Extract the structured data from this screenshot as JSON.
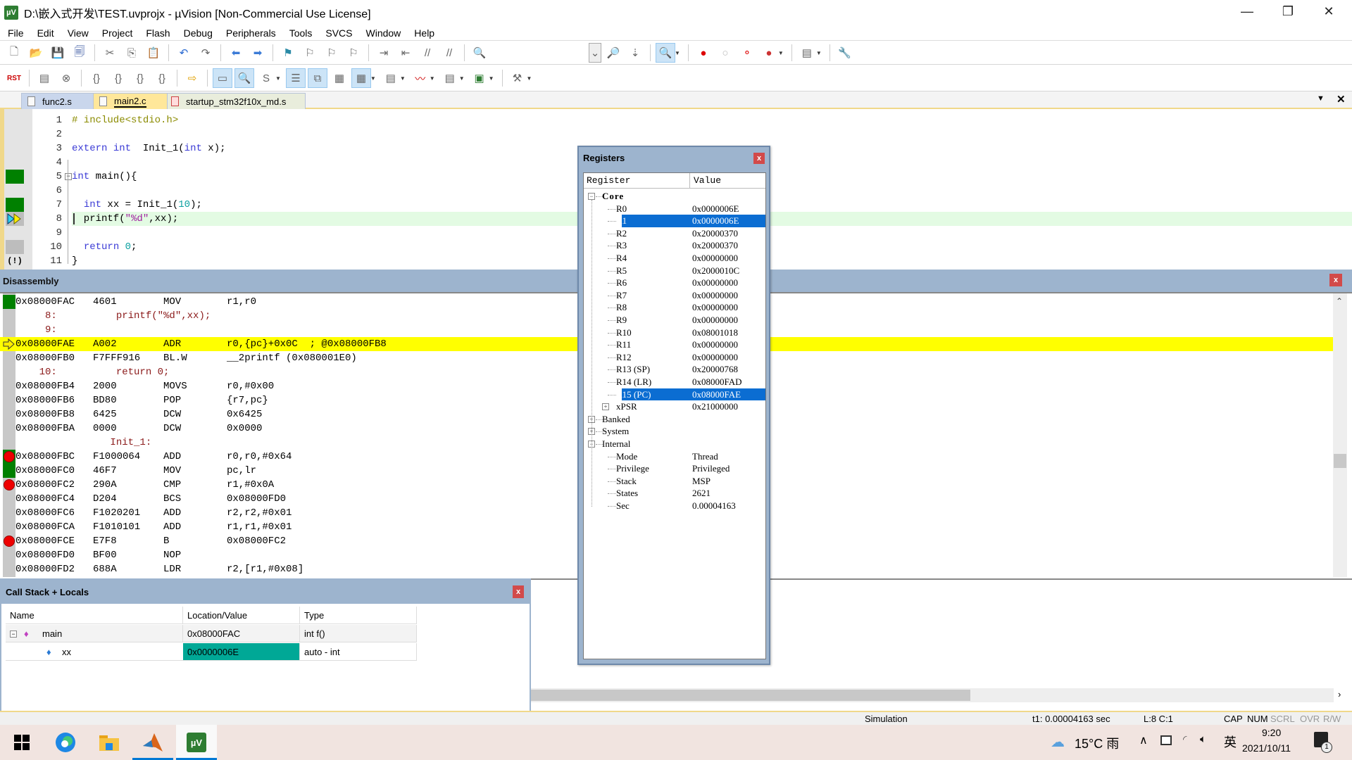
{
  "window": {
    "title": "D:\\嵌入式开发\\TEST.uvprojx - µVision  [Non-Commercial Use License]",
    "app_icon_label": "µV",
    "controls": {
      "minimize": "—",
      "restore": "❐",
      "close": "✕"
    }
  },
  "menu": [
    "File",
    "Edit",
    "View",
    "Project",
    "Flash",
    "Debug",
    "Peripherals",
    "Tools",
    "SVCS",
    "Window",
    "Help"
  ],
  "toolbar1": {
    "icons": [
      "new-file",
      "open-file",
      "save",
      "save-all",
      "cut",
      "copy",
      "paste",
      "undo",
      "redo",
      "navigate-back",
      "navigate-forward",
      "bookmark",
      "prev-bookmark",
      "next-bookmark",
      "clear-bookmarks",
      "indent",
      "unindent",
      "comment",
      "uncomment",
      "find-in-files"
    ],
    "right_icons": [
      "target-dropdown",
      "find",
      "incremental-find",
      "debug-session",
      "insert-breakpoint",
      "enable-breakpoint",
      "disable-all-breakpoints",
      "kill-all-breakpoints",
      "window-layout",
      "configure"
    ]
  },
  "toolbar2": {
    "icons": [
      "reset",
      "run",
      "stop",
      "step-into",
      "step-over",
      "step-out",
      "run-to-cursor",
      "show-next-statement",
      "command-window",
      "disassembly-window",
      "symbols-window",
      "registers-window",
      "call-stack-window",
      "watch-windows",
      "memory-windows",
      "serial-windows",
      "analysis-windows",
      "trace-windows",
      "system-viewer",
      "toolbox"
    ],
    "reset_label": "RST"
  },
  "tabs": [
    {
      "label": "func2.s",
      "active": false
    },
    {
      "label": "main2.c",
      "active": true
    },
    {
      "label": "startup_stm32f10x_md.s",
      "active": false
    }
  ],
  "tabbar_controls": {
    "dropdown": "▼",
    "close": "✕"
  },
  "editor": {
    "lines": [
      {
        "n": "1",
        "code": "# include<stdio.h>"
      },
      {
        "n": "2",
        "code": ""
      },
      {
        "n": "3",
        "code": "extern int  Init_1(int x);"
      },
      {
        "n": "4",
        "code": ""
      },
      {
        "n": "5",
        "code": "int main(){"
      },
      {
        "n": "6",
        "code": ""
      },
      {
        "n": "7",
        "code": "  int xx = Init_1(10);"
      },
      {
        "n": "8",
        "code": "  printf(\"%d\",xx);"
      },
      {
        "n": "9",
        "code": ""
      },
      {
        "n": "10",
        "code": "  return 0;"
      },
      {
        "n": "11",
        "code": "}"
      }
    ],
    "current_line": 8,
    "warning_glyph": "!"
  },
  "disassembly": {
    "title": "Disassembly",
    "close": "x",
    "rows": [
      {
        "type": "asm",
        "addr": "0x08000FAC",
        "op": "4601",
        "mn": "MOV",
        "arg": "r1,r0",
        "mark": "exec"
      },
      {
        "type": "src",
        "text": "     8:          printf(\"%d\",xx);"
      },
      {
        "type": "src",
        "text": "     9:"
      },
      {
        "type": "asm",
        "addr": "0x08000FAE",
        "op": "A002",
        "mn": "ADR",
        "arg": "r0,{pc}+0x0C  ; @0x08000FB8",
        "mark": "current"
      },
      {
        "type": "asm",
        "addr": "0x08000FB0",
        "op": "F7FFF916",
        "mn": "BL.W",
        "arg": "__2printf (0x080001E0)",
        "mark": ""
      },
      {
        "type": "src",
        "text": "    10:          return 0;"
      },
      {
        "type": "asm",
        "addr": "0x08000FB4",
        "op": "2000",
        "mn": "MOVS",
        "arg": "r0,#0x00",
        "mark": ""
      },
      {
        "type": "asm",
        "addr": "0x08000FB6",
        "op": "BD80",
        "mn": "POP",
        "arg": "{r7,pc}",
        "mark": ""
      },
      {
        "type": "asm",
        "addr": "0x08000FB8",
        "op": "6425",
        "mn": "DCW",
        "arg": "0x6425",
        "mark": ""
      },
      {
        "type": "asm",
        "addr": "0x08000FBA",
        "op": "0000",
        "mn": "DCW",
        "arg": "0x0000",
        "mark": ""
      },
      {
        "type": "src",
        "text": "                Init_1:"
      },
      {
        "type": "asm",
        "addr": "0x08000FBC",
        "op": "F1000064",
        "mn": "ADD",
        "arg": "r0,r0,#0x64",
        "mark": "bp-exec"
      },
      {
        "type": "asm",
        "addr": "0x08000FC0",
        "op": "46F7",
        "mn": "MOV",
        "arg": "pc,lr",
        "mark": "exec"
      },
      {
        "type": "asm",
        "addr": "0x08000FC2",
        "op": "290A",
        "mn": "CMP",
        "arg": "r1,#0x0A",
        "mark": "bp"
      },
      {
        "type": "asm",
        "addr": "0x08000FC4",
        "op": "D204",
        "mn": "BCS",
        "arg": "0x08000FD0",
        "mark": ""
      },
      {
        "type": "asm",
        "addr": "0x08000FC6",
        "op": "F1020201",
        "mn": "ADD",
        "arg": "r2,r2,#0x01",
        "mark": ""
      },
      {
        "type": "asm",
        "addr": "0x08000FCA",
        "op": "F1010101",
        "mn": "ADD",
        "arg": "r1,r1,#0x01",
        "mark": ""
      },
      {
        "type": "asm",
        "addr": "0x08000FCE",
        "op": "E7F8",
        "mn": "B",
        "arg": "0x08000FC2",
        "mark": "bp"
      },
      {
        "type": "asm",
        "addr": "0x08000FD0",
        "op": "BF00",
        "mn": "NOP",
        "arg": "",
        "mark": ""
      },
      {
        "type": "asm",
        "addr": "0x08000FD2",
        "op": "688A",
        "mn": "LDR",
        "arg": "r2,[r1,#0x08]",
        "mark": ""
      }
    ]
  },
  "registers": {
    "title": "Registers",
    "close": "x",
    "columns": [
      "Register",
      "Value"
    ],
    "core_label": "Core",
    "core": [
      {
        "name": "R0",
        "value": "0x0000006E"
      },
      {
        "name": "R1",
        "value": "0x0000006E",
        "selected": true
      },
      {
        "name": "R2",
        "value": "0x20000370"
      },
      {
        "name": "R3",
        "value": "0x20000370"
      },
      {
        "name": "R4",
        "value": "0x00000000"
      },
      {
        "name": "R5",
        "value": "0x2000010C"
      },
      {
        "name": "R6",
        "value": "0x00000000"
      },
      {
        "name": "R7",
        "value": "0x00000000"
      },
      {
        "name": "R8",
        "value": "0x00000000"
      },
      {
        "name": "R9",
        "value": "0x00000000"
      },
      {
        "name": "R10",
        "value": "0x08001018"
      },
      {
        "name": "R11",
        "value": "0x00000000"
      },
      {
        "name": "R12",
        "value": "0x00000000"
      },
      {
        "name": "R13 (SP)",
        "value": "0x20000768"
      },
      {
        "name": "R14 (LR)",
        "value": "0x08000FAD"
      },
      {
        "name": "R15 (PC)",
        "value": "0x08000FAE",
        "selected": true
      },
      {
        "name": "xPSR",
        "value": "0x21000000",
        "expandable": true
      }
    ],
    "groups": [
      "Banked",
      "System"
    ],
    "internal_label": "Internal",
    "internal": [
      {
        "name": "Mode",
        "value": "Thread"
      },
      {
        "name": "Privilege",
        "value": "Privileged"
      },
      {
        "name": "Stack",
        "value": "MSP"
      },
      {
        "name": "States",
        "value": "2621"
      },
      {
        "name": "Sec",
        "value": "0.00004163"
      }
    ]
  },
  "callstack": {
    "title": "Call Stack + Locals",
    "close": "x",
    "columns": [
      "Name",
      "Location/Value",
      "Type"
    ],
    "rows": [
      {
        "name": "main",
        "value": "0x08000FAC",
        "type": "int f()"
      },
      {
        "name": "xx",
        "value": "0x0000006E",
        "type": "auto - int",
        "changed": true
      }
    ]
  },
  "statusbar": {
    "mode": "Simulation",
    "time": "t1: 0.00004163 sec",
    "position": "L:8 C:1",
    "indicators": [
      {
        "label": "CAP",
        "on": true
      },
      {
        "label": "NUM",
        "on": true
      },
      {
        "label": "SCRL",
        "on": false
      },
      {
        "label": "OVR",
        "on": false
      },
      {
        "label": "R/W",
        "on": false
      }
    ]
  },
  "taskbar": {
    "apps": [
      "start",
      "edge",
      "file-explorer",
      "matlab",
      "keil-uvision"
    ],
    "weather": "15°C 雨",
    "ime": "英",
    "time": "9:20",
    "date": "2021/10/11",
    "notification_count": "1"
  },
  "colors": {
    "panel_header": "#9db4ce",
    "current_line": "#ffff00",
    "selection": "#0b6dd2",
    "changed_value": "#00a896",
    "breakpoint": "#ee0000",
    "executed": "#008000"
  }
}
